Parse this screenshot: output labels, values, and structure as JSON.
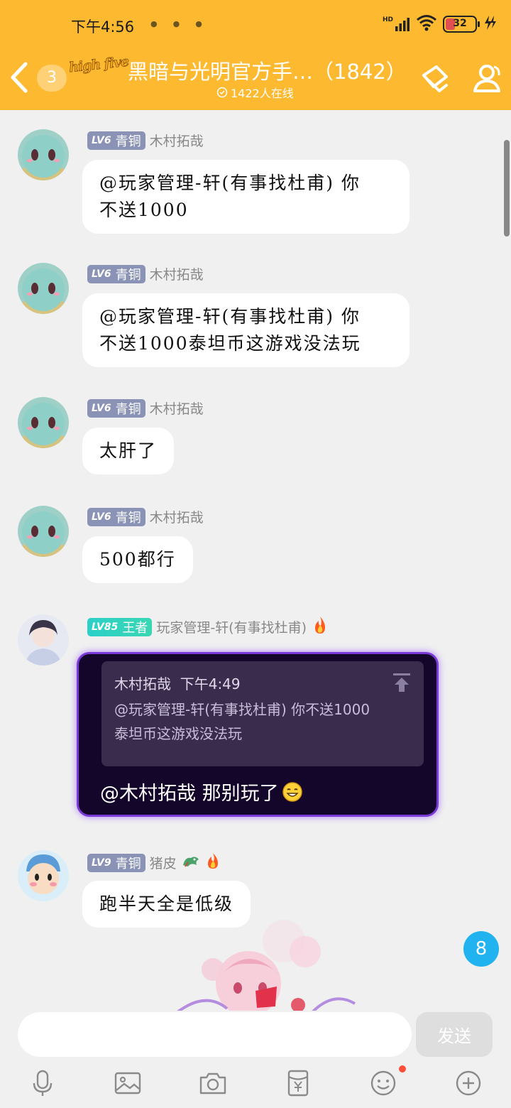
{
  "status_bar": {
    "time": "下午4:56",
    "signal_label": "HD",
    "battery": "32"
  },
  "header": {
    "unread_count": "3",
    "logo_text": "high five",
    "group_name": "黑暗与光明官方手…（1842）",
    "online": "1422人在线"
  },
  "messages": [
    {
      "level": "LV6",
      "rank": "青铜",
      "sender": "木村拓哉",
      "text_lines": [
        "@玩家管理-轩(有事找杜甫) 你",
        "不送1000"
      ]
    },
    {
      "level": "LV6",
      "rank": "青铜",
      "sender": "木村拓哉",
      "text_lines": [
        "@玩家管理-轩(有事找杜甫) 你",
        "不送1000泰坦币这游戏没法玩"
      ]
    },
    {
      "level": "LV6",
      "rank": "青铜",
      "sender": "木村拓哉",
      "text_lines": [
        "太肝了"
      ]
    },
    {
      "level": "LV6",
      "rank": "青铜",
      "sender": "木村拓哉",
      "text_lines": [
        "500都行"
      ]
    }
  ],
  "admin_message": {
    "level": "LV85",
    "rank": "王者",
    "sender": "玩家管理-轩(有事找杜甫)",
    "quote": {
      "author": "木村拓哉",
      "time": "下午4:49",
      "lines": [
        "@玩家管理-轩(有事找杜甫) 你不送1000",
        "泰坦币这游戏没法玩"
      ]
    },
    "reply": "@木村拓哉 那别玩了"
  },
  "last_message": {
    "level": "LV9",
    "rank": "青铜",
    "sender": "猪皮",
    "text": "跑半天全是低级"
  },
  "new_messages_badge": "8",
  "input": {
    "placeholder": "",
    "send_label": "发送"
  },
  "toolbar_icons": [
    "microphone-icon",
    "image-icon",
    "camera-icon",
    "red-packet-icon",
    "emoji-icon",
    "plus-icon"
  ],
  "colors": {
    "header_bg": "#fdb92f",
    "level_badge": "#8a93b5",
    "admin_bubble_bg": "#14052a",
    "admin_bubble_border": "#7b3ad8",
    "unread_badge": "#20b3f0"
  }
}
